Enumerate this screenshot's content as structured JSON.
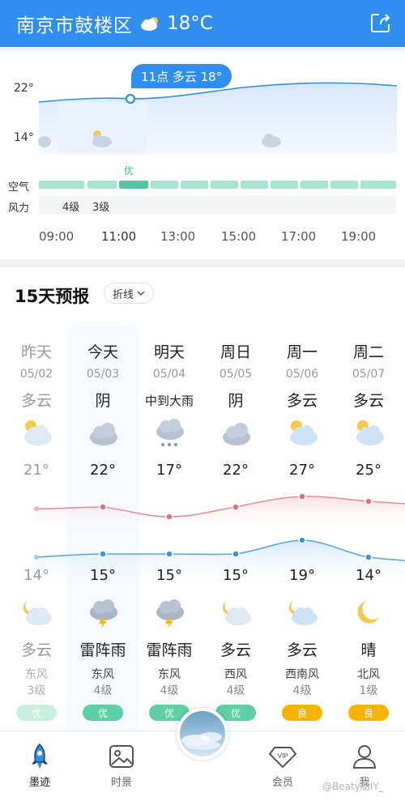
{
  "header": {
    "location": "南京市鼓楼区",
    "temperature": "18°C",
    "weather_icon": "cloud-icon",
    "share_icon": "share-icon",
    "bg_color": "#2f8ef0"
  },
  "hourly": {
    "tooltip": "11点 多云 18°",
    "y_labels": [
      "22°",
      "14°"
    ],
    "air_label": "空气",
    "wind_label": "风力",
    "air_good": "优",
    "wind_values": [
      "4级",
      "3级"
    ],
    "times": [
      "09:00",
      "11:00",
      "13:00",
      "15:00",
      "17:00",
      "19:00"
    ]
  },
  "daily": {
    "title": "15天预报",
    "mode": "折线",
    "days": [
      {
        "name": "昨天",
        "date": "05/02",
        "day_cond": "多云",
        "high": "21°",
        "low": "14°",
        "night_cond": "多云",
        "wind_dir": "东风",
        "wind_level": "3级",
        "aq": "优"
      },
      {
        "name": "今天",
        "date": "05/03",
        "day_cond": "阴",
        "high": "22°",
        "low": "15°",
        "night_cond": "雷阵雨",
        "wind_dir": "东风",
        "wind_level": "4级",
        "aq": "优"
      },
      {
        "name": "明天",
        "date": "05/04",
        "day_cond": "中到大雨",
        "high": "17°",
        "low": "15°",
        "night_cond": "雷阵雨",
        "wind_dir": "东风",
        "wind_level": "4级",
        "aq": "优"
      },
      {
        "name": "周日",
        "date": "05/05",
        "day_cond": "阴",
        "high": "22°",
        "low": "15°",
        "night_cond": "多云",
        "wind_dir": "西风",
        "wind_level": "4级",
        "aq": "优"
      },
      {
        "name": "周一",
        "date": "05/06",
        "day_cond": "多云",
        "high": "27°",
        "low": "19°",
        "night_cond": "多云",
        "wind_dir": "西南风",
        "wind_level": "4级",
        "aq": "良"
      },
      {
        "name": "周二",
        "date": "05/07",
        "day_cond": "多云",
        "high": "25°",
        "low": "14°",
        "night_cond": "晴",
        "wind_dir": "北风",
        "wind_level": "1级",
        "aq": "良"
      }
    ],
    "aq_colors": {
      "优": "#5dd0a6",
      "良": "#f5b400"
    }
  },
  "nav": {
    "items": [
      {
        "label": "墨迹",
        "icon": "rocket-icon"
      },
      {
        "label": "时景",
        "icon": "image-icon"
      },
      {
        "label": "会员",
        "icon": "vip-icon"
      },
      {
        "label": "我",
        "icon": "user-icon"
      }
    ]
  },
  "watermark": "@Beaty酷IY_"
}
